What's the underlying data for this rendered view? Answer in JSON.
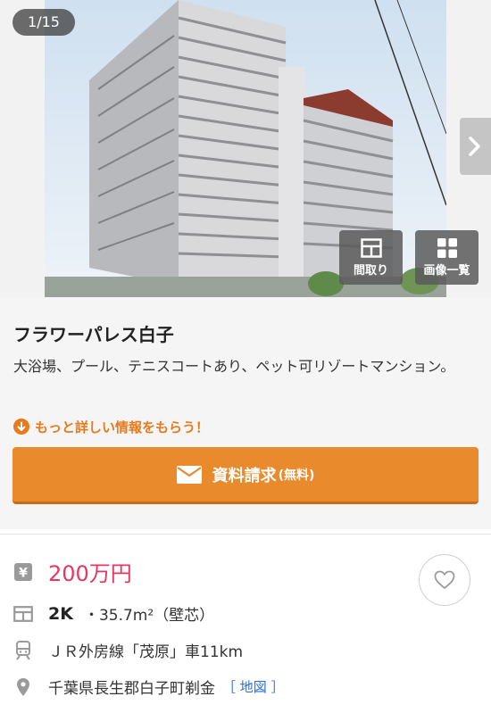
{
  "gallery": {
    "counter": "1/15",
    "floorplan_label": "間取り",
    "gallery_label": "画像一覧"
  },
  "property": {
    "name": "フラワーパレス白子",
    "description": "大浴場、プール、テニスコートあり、ペット可リゾートマンション。",
    "more_info_link": "もっと詳しい情報をもらう！",
    "request_button": {
      "label": "資料請求",
      "sub_label": "(無料)"
    }
  },
  "details": {
    "price": "200万円",
    "layout": "2K",
    "area": "・35.7m²（壁芯）",
    "access": "ＪＲ外房線「茂原」車11km",
    "address": "千葉県長生郡白子町剃金",
    "map_link": "［ 地図 ］"
  },
  "colors": {
    "accent": "#e98a2c",
    "price": "#e6385f",
    "link": "#2a6fd6"
  }
}
